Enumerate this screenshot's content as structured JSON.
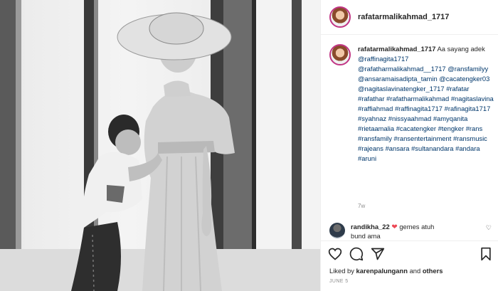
{
  "post": {
    "username": "rafatarmalikahmad_1717",
    "caption": {
      "username": "rafatarmalikahmad_1717",
      "text_start": "Aa sayang adek",
      "mentions": [
        "@raffinagita1717",
        "@rafatharmalikahmad__1717",
        "@ransfamilyy",
        "@ansaramaisadipta_tamin",
        "@cacatengker03",
        "@nagitaslavinatengker_1717"
      ],
      "hashtags": [
        "#rafatar",
        "#rafathar",
        "#rafatharmalikahmad",
        "#nagitaslavina",
        "#raffiahmad",
        "#raffinagita1717",
        "#rafinagita1717",
        "#syahnaz",
        "#nissyaahmad",
        "#amyqanita",
        "#rietaamalia",
        "#cacatengker",
        "#tengker",
        "#rans",
        "#ransfamily",
        "#ransentertainment",
        "#ransmusic",
        "#rajeans",
        "#ansara",
        "#sultanandara",
        "#andara",
        "#aruni"
      ],
      "age": "7w"
    },
    "comment": {
      "username": "randikha_22",
      "text": "gemes atuh",
      "text2": "bund ama"
    },
    "icons": {
      "like": "heart-icon",
      "comment": "comment-icon",
      "share": "share-icon",
      "save": "bookmark-icon"
    },
    "likes": {
      "prefix": "Liked by",
      "user": "karenpalungann",
      "suffix": "and",
      "others": "others"
    },
    "date": "JUNE 5"
  }
}
